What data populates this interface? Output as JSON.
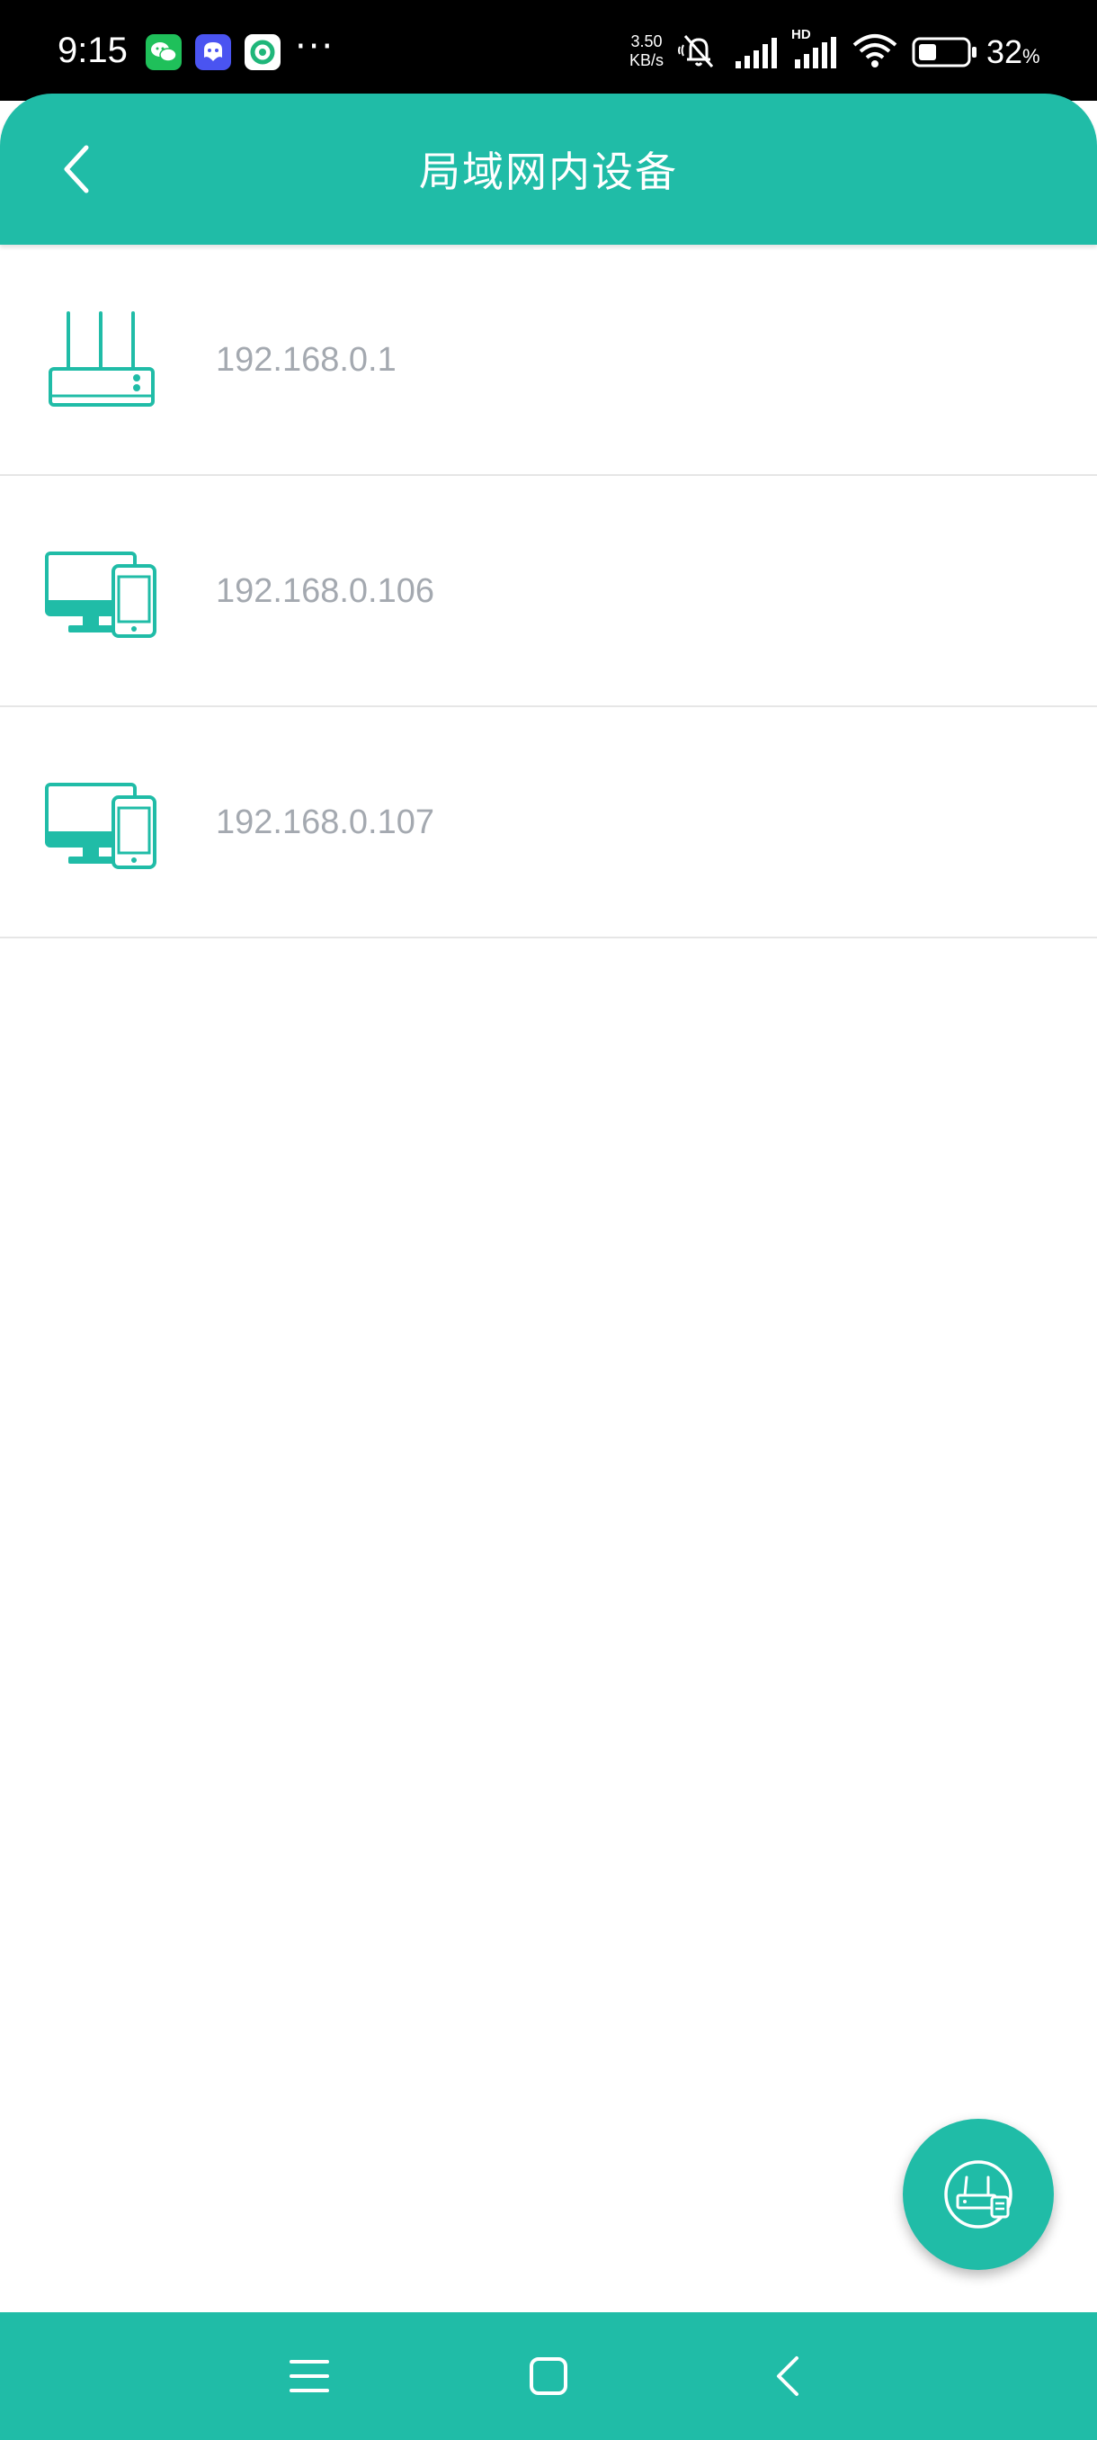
{
  "status_bar": {
    "time": "9:15",
    "notification_icons": [
      "wechat-icon",
      "qq-icon",
      "app-icon"
    ],
    "more_indicator": "···",
    "net_speed": "3.50",
    "net_speed_unit": "KB/s",
    "network_type": "HD",
    "battery_level": "32",
    "battery_unit": "%"
  },
  "header": {
    "title": "局域网内设备",
    "back_icon": "chevron-left-icon"
  },
  "devices": [
    {
      "icon": "router-icon",
      "ip": "192.168.0.1"
    },
    {
      "icon": "computer-phone-icon",
      "ip": "192.168.0.106"
    },
    {
      "icon": "computer-phone-icon",
      "ip": "192.168.0.107"
    }
  ],
  "fab": {
    "icon": "router-scan-icon"
  },
  "nav_bar": {
    "buttons": [
      "menu-icon",
      "home-icon",
      "back-icon"
    ]
  },
  "colors": {
    "accent": "#20BCA7",
    "ip_text": "#A4A9B0",
    "divider": "#E6E6E6",
    "status_bar_bg": "#000000"
  }
}
